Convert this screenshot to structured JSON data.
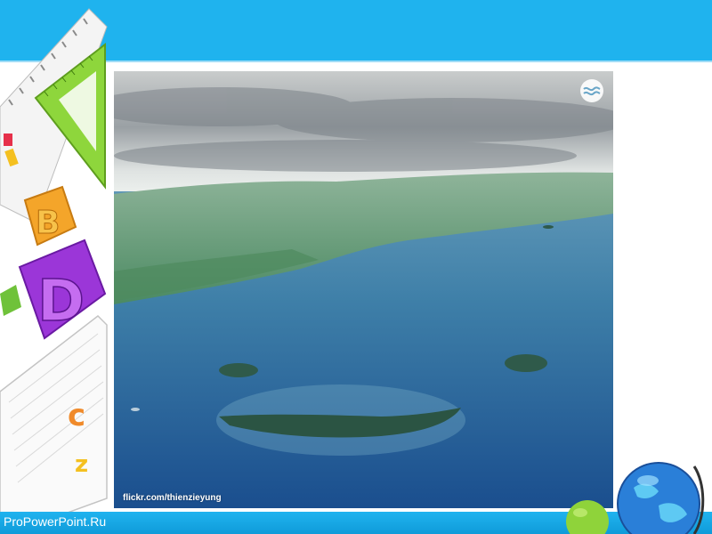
{
  "footer": {
    "site_label": "ProPowerPoint.Ru"
  },
  "photo": {
    "credit": "flickr.com/thienzieyung",
    "logo_icon": "wave-logo-icon",
    "subject": "aerial-ocean-islands-smile"
  },
  "decor": {
    "left_icons": [
      "ruler-icon",
      "letter-b-block-icon",
      "letter-d-block-icon",
      "open-book-icon"
    ],
    "corner_icons": [
      "globe-icon",
      "apple-icon"
    ]
  },
  "colors": {
    "header_blue": "#1fb3ee",
    "footer_blue": "#20b3ef"
  }
}
